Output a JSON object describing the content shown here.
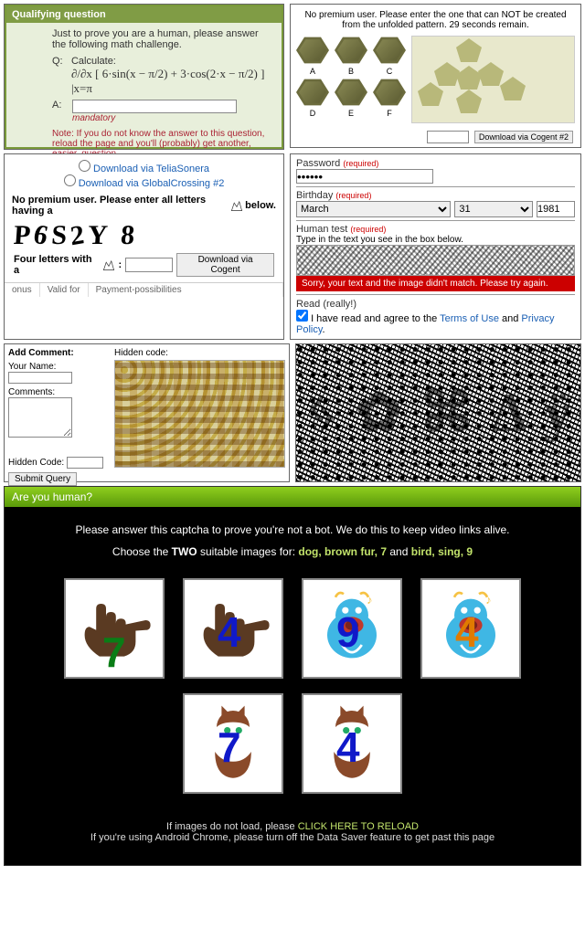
{
  "qualifying": {
    "header": "Qualifying question",
    "intro": "Just to prove you are a human, please answer the following math challenge.",
    "q_label": "Q:",
    "q_text": "Calculate:",
    "math": "∂/∂x [ 6·sin(x − π/2) + 3·cos(2·x − π/2) ] |x=π",
    "a_label": "A:",
    "mandatory": "mandatory",
    "note": "Note: If you do not know the answer to this question, reload the page and you'll (probably) get another, easier, question."
  },
  "unfold": {
    "prompt": "No premium user. Please enter the one that can NOT be created from the unfolded pattern. 29 seconds remain.",
    "labels": [
      "A",
      "B",
      "C",
      "D",
      "E",
      "F"
    ],
    "button": "Download via Cogent #2"
  },
  "foxcaptcha": {
    "radio1": "Download via TeliaSonera",
    "radio2": "Download via GlobalCrossing #2",
    "line": "No premium user. Please enter all letters having a",
    "line_suffix": "below.",
    "distorted": "P6S2Y8",
    "answer_prefix": "Four letters with a",
    "button": "Download via Cogent",
    "footer_cols": [
      "onus",
      "Valid for",
      "Payment-possibilities"
    ]
  },
  "password_panel": {
    "pw_label": "Password",
    "req": "(required)",
    "pw_value": "••••••",
    "bd_label": "Birthday",
    "month": "March",
    "day": "31",
    "year": "1981",
    "ht_label": "Human test",
    "ht_hint": "Type in the text you see in the box below.",
    "error": "Sorry, your text and the image didn't match. Please try again.",
    "read_label": "Read (really!)",
    "agree_text": "I have read and agree to the ",
    "terms": "Terms of Use",
    "and": " and ",
    "privacy": "Privacy Policy",
    "dot": "."
  },
  "add_comment": {
    "title": "Add Comment:",
    "hidden_label_top": "Hidden code:",
    "name_label": "Your Name:",
    "comments_label": "Comments:",
    "hidden_label": "Hidden Code:",
    "submit": "Submit Query"
  },
  "glyph_noise": {
    "chars": [
      "ᛃ",
      "✿",
      "⌘",
      "Δ",
      "ÿ"
    ]
  },
  "ayh": {
    "header": "Are you human?",
    "line1": "Please answer this captcha to prove you're not a bot. We do this to keep video links alive.",
    "line2_pre": "Choose the ",
    "line2_two": "TWO",
    "line2_mid": " suitable images for: ",
    "prompt1": "dog, brown fur, 7",
    "and": " and ",
    "prompt2": "bird, sing, 9",
    "foot1_pre": "If images do not load, please ",
    "foot1_link": "CLICK HERE TO RELOAD",
    "foot2": "If you're using Android Chrome, please turn off the Data Saver feature to get past this page",
    "tiles": [
      {
        "kind": "hand",
        "num": "7",
        "numClass": "g"
      },
      {
        "kind": "hand",
        "num": "4",
        "numClass": "b"
      },
      {
        "kind": "bird",
        "num": "9",
        "numClass": "b"
      },
      {
        "kind": "bird",
        "num": "4",
        "numClass": "o"
      },
      {
        "kind": "cat",
        "num": "7",
        "numClass": "b"
      },
      {
        "kind": "cat",
        "num": "4",
        "numClass": "b"
      }
    ]
  }
}
